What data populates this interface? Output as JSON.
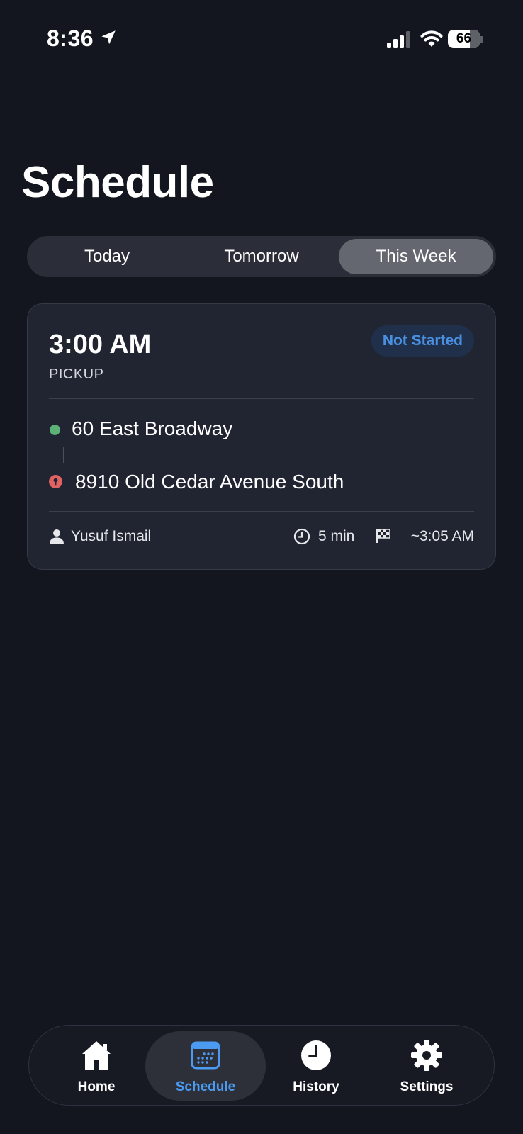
{
  "status_bar": {
    "time": "8:36",
    "battery": "66"
  },
  "page": {
    "title": "Schedule"
  },
  "segments": [
    {
      "label": "Today",
      "active": false
    },
    {
      "label": "Tomorrow",
      "active": false
    },
    {
      "label": "This Week",
      "active": true
    }
  ],
  "ride": {
    "time": "3:00 AM",
    "type": "PICKUP",
    "status": "Not Started",
    "pickup_address": "60 East Broadway",
    "dropoff_address": "8910 Old Cedar Avenue South",
    "driver": "Yusuf Ismail",
    "duration": "5 min",
    "eta": "~3:05 AM"
  },
  "tabs": [
    {
      "label": "Home",
      "icon": "house-icon",
      "active": false
    },
    {
      "label": "Schedule",
      "icon": "calendar-icon",
      "active": true
    },
    {
      "label": "History",
      "icon": "clock-icon",
      "active": false
    },
    {
      "label": "Settings",
      "icon": "gear-icon",
      "active": false
    }
  ],
  "colors": {
    "background": "#13161f",
    "card": "#212532",
    "accent": "#4a9bf1",
    "pickup": "#5cb176",
    "dropoff": "#e06262"
  }
}
